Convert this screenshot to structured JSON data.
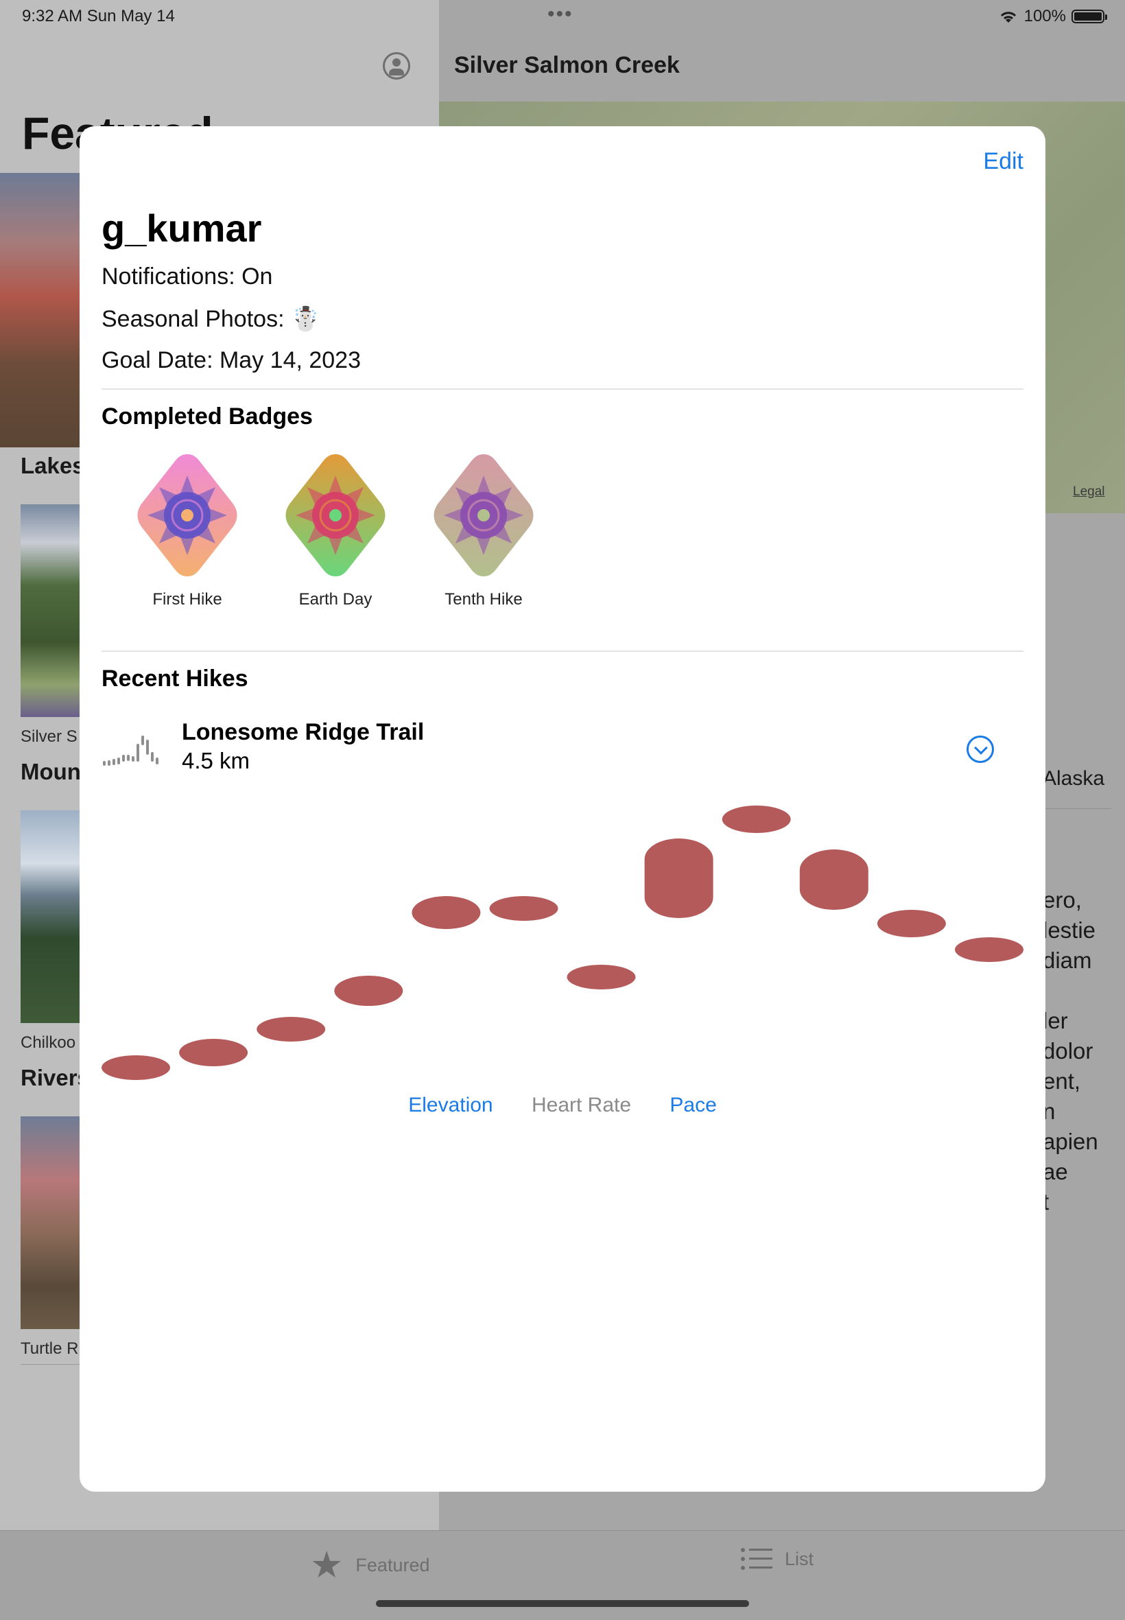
{
  "status": {
    "time": "9:32 AM   Sun May 14",
    "battery": "100%"
  },
  "background": {
    "featured_title": "Featured",
    "detail_title": "Silver Salmon Creek",
    "map_legal": "Legal",
    "sections": [
      "Lakes",
      "Moun",
      "Rivers"
    ],
    "captions": [
      "Silver S",
      "Chilkoo",
      "Turtle R"
    ],
    "detail_location": "Alaska",
    "detail_text": [
      "ero,",
      "lestie",
      "diam",
      "",
      "ler",
      "dolor",
      "ent,",
      "n",
      "apien",
      "ae",
      "t"
    ]
  },
  "profile": {
    "edit_label": "Edit",
    "username": "g_kumar",
    "notifications": "Notifications: On",
    "seasonal": "Seasonal Photos: ☃️",
    "goal_date": "Goal Date: May 14, 2023"
  },
  "badges": {
    "heading": "Completed Badges",
    "items": [
      {
        "label": "First Hike",
        "top_color": "#f08ad6",
        "bottom_color": "#f4b070",
        "center_color": "#5b4fc8"
      },
      {
        "label": "Earth Day",
        "top_color": "#e39a3a",
        "bottom_color": "#6ad67c",
        "center_color": "#d83a6a"
      },
      {
        "label": "Tenth Hike",
        "top_color": "#d69aa6",
        "bottom_color": "#b2c08c",
        "center_color": "#8a4ab0"
      }
    ]
  },
  "hikes": {
    "heading": "Recent Hikes",
    "name": "Lonesome Ridge Trail",
    "distance": "4.5 km"
  },
  "metrics": {
    "elevation": "Elevation",
    "heart_rate": "Heart Rate",
    "pace": "Pace",
    "selected": "heart_rate"
  },
  "tabs": {
    "featured": "Featured",
    "list": "List"
  },
  "chart_data": {
    "type": "bar",
    "mark": "capsule-range",
    "bar_color": "#b55a5a",
    "x": [
      1,
      2,
      3,
      4,
      5,
      6,
      7,
      8,
      9,
      10,
      11,
      12
    ],
    "series": [
      {
        "low": [
          0.0,
          0.05,
          0.14,
          0.27,
          0.55,
          0.58,
          0.33,
          0.59,
          0.9,
          0.62,
          0.52,
          0.43
        ],
        "high": [
          0.09,
          0.15,
          0.23,
          0.38,
          0.67,
          0.67,
          0.42,
          0.88,
          1.0,
          0.84,
          0.62,
          0.52
        ]
      }
    ]
  }
}
